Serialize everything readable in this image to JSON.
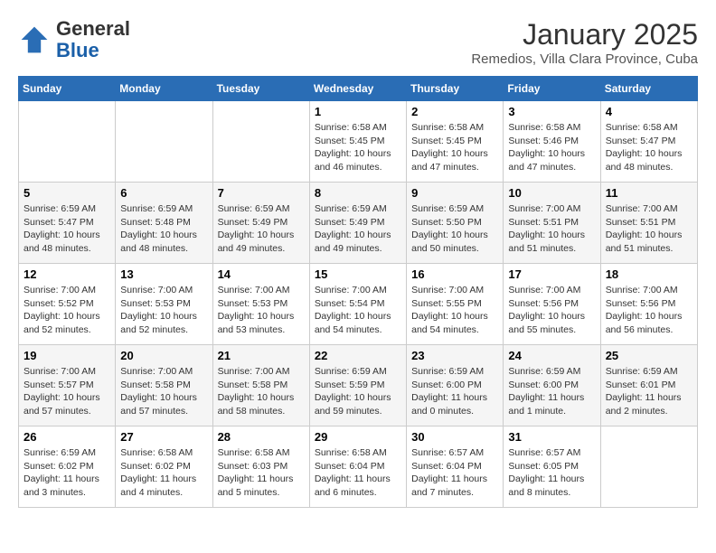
{
  "header": {
    "logo_general": "General",
    "logo_blue": "Blue",
    "month": "January 2025",
    "location": "Remedios, Villa Clara Province, Cuba"
  },
  "days_of_week": [
    "Sunday",
    "Monday",
    "Tuesday",
    "Wednesday",
    "Thursday",
    "Friday",
    "Saturday"
  ],
  "weeks": [
    [
      {
        "day": "",
        "info": ""
      },
      {
        "day": "",
        "info": ""
      },
      {
        "day": "",
        "info": ""
      },
      {
        "day": "1",
        "info": "Sunrise: 6:58 AM\nSunset: 5:45 PM\nDaylight: 10 hours\nand 46 minutes."
      },
      {
        "day": "2",
        "info": "Sunrise: 6:58 AM\nSunset: 5:45 PM\nDaylight: 10 hours\nand 47 minutes."
      },
      {
        "day": "3",
        "info": "Sunrise: 6:58 AM\nSunset: 5:46 PM\nDaylight: 10 hours\nand 47 minutes."
      },
      {
        "day": "4",
        "info": "Sunrise: 6:58 AM\nSunset: 5:47 PM\nDaylight: 10 hours\nand 48 minutes."
      }
    ],
    [
      {
        "day": "5",
        "info": "Sunrise: 6:59 AM\nSunset: 5:47 PM\nDaylight: 10 hours\nand 48 minutes."
      },
      {
        "day": "6",
        "info": "Sunrise: 6:59 AM\nSunset: 5:48 PM\nDaylight: 10 hours\nand 48 minutes."
      },
      {
        "day": "7",
        "info": "Sunrise: 6:59 AM\nSunset: 5:49 PM\nDaylight: 10 hours\nand 49 minutes."
      },
      {
        "day": "8",
        "info": "Sunrise: 6:59 AM\nSunset: 5:49 PM\nDaylight: 10 hours\nand 49 minutes."
      },
      {
        "day": "9",
        "info": "Sunrise: 6:59 AM\nSunset: 5:50 PM\nDaylight: 10 hours\nand 50 minutes."
      },
      {
        "day": "10",
        "info": "Sunrise: 7:00 AM\nSunset: 5:51 PM\nDaylight: 10 hours\nand 51 minutes."
      },
      {
        "day": "11",
        "info": "Sunrise: 7:00 AM\nSunset: 5:51 PM\nDaylight: 10 hours\nand 51 minutes."
      }
    ],
    [
      {
        "day": "12",
        "info": "Sunrise: 7:00 AM\nSunset: 5:52 PM\nDaylight: 10 hours\nand 52 minutes."
      },
      {
        "day": "13",
        "info": "Sunrise: 7:00 AM\nSunset: 5:53 PM\nDaylight: 10 hours\nand 52 minutes."
      },
      {
        "day": "14",
        "info": "Sunrise: 7:00 AM\nSunset: 5:53 PM\nDaylight: 10 hours\nand 53 minutes."
      },
      {
        "day": "15",
        "info": "Sunrise: 7:00 AM\nSunset: 5:54 PM\nDaylight: 10 hours\nand 54 minutes."
      },
      {
        "day": "16",
        "info": "Sunrise: 7:00 AM\nSunset: 5:55 PM\nDaylight: 10 hours\nand 54 minutes."
      },
      {
        "day": "17",
        "info": "Sunrise: 7:00 AM\nSunset: 5:56 PM\nDaylight: 10 hours\nand 55 minutes."
      },
      {
        "day": "18",
        "info": "Sunrise: 7:00 AM\nSunset: 5:56 PM\nDaylight: 10 hours\nand 56 minutes."
      }
    ],
    [
      {
        "day": "19",
        "info": "Sunrise: 7:00 AM\nSunset: 5:57 PM\nDaylight: 10 hours\nand 57 minutes."
      },
      {
        "day": "20",
        "info": "Sunrise: 7:00 AM\nSunset: 5:58 PM\nDaylight: 10 hours\nand 57 minutes."
      },
      {
        "day": "21",
        "info": "Sunrise: 7:00 AM\nSunset: 5:58 PM\nDaylight: 10 hours\nand 58 minutes."
      },
      {
        "day": "22",
        "info": "Sunrise: 6:59 AM\nSunset: 5:59 PM\nDaylight: 10 hours\nand 59 minutes."
      },
      {
        "day": "23",
        "info": "Sunrise: 6:59 AM\nSunset: 6:00 PM\nDaylight: 11 hours\nand 0 minutes."
      },
      {
        "day": "24",
        "info": "Sunrise: 6:59 AM\nSunset: 6:00 PM\nDaylight: 11 hours\nand 1 minute."
      },
      {
        "day": "25",
        "info": "Sunrise: 6:59 AM\nSunset: 6:01 PM\nDaylight: 11 hours\nand 2 minutes."
      }
    ],
    [
      {
        "day": "26",
        "info": "Sunrise: 6:59 AM\nSunset: 6:02 PM\nDaylight: 11 hours\nand 3 minutes."
      },
      {
        "day": "27",
        "info": "Sunrise: 6:58 AM\nSunset: 6:02 PM\nDaylight: 11 hours\nand 4 minutes."
      },
      {
        "day": "28",
        "info": "Sunrise: 6:58 AM\nSunset: 6:03 PM\nDaylight: 11 hours\nand 5 minutes."
      },
      {
        "day": "29",
        "info": "Sunrise: 6:58 AM\nSunset: 6:04 PM\nDaylight: 11 hours\nand 6 minutes."
      },
      {
        "day": "30",
        "info": "Sunrise: 6:57 AM\nSunset: 6:04 PM\nDaylight: 11 hours\nand 7 minutes."
      },
      {
        "day": "31",
        "info": "Sunrise: 6:57 AM\nSunset: 6:05 PM\nDaylight: 11 hours\nand 8 minutes."
      },
      {
        "day": "",
        "info": ""
      }
    ]
  ]
}
